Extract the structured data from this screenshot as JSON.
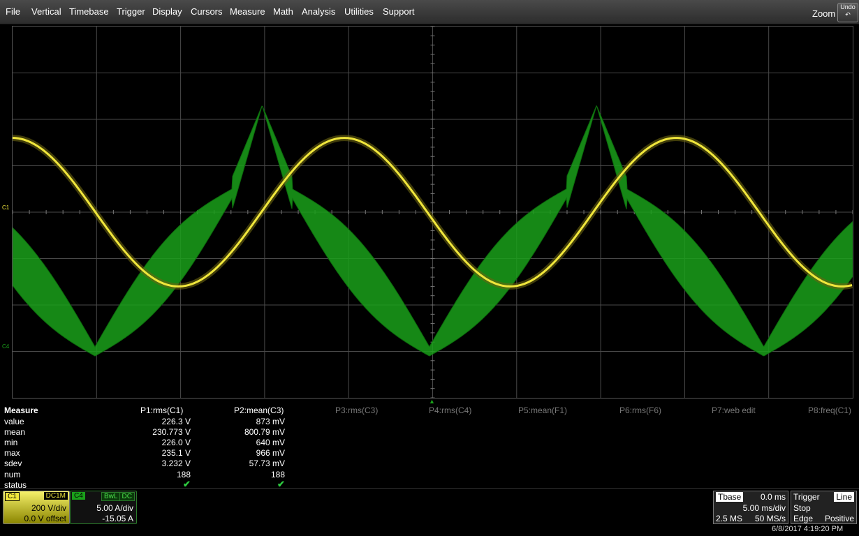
{
  "menu": [
    "File",
    "Vertical",
    "Timebase",
    "Trigger",
    "Display",
    "Cursors",
    "Measure",
    "Math",
    "Analysis",
    "Utilities",
    "Support"
  ],
  "toolbar": {
    "zoom": "Zoom",
    "undo": "Undo"
  },
  "markers": {
    "c1": "C1",
    "c4": "C4"
  },
  "colors": {
    "c1": "#f0e63c",
    "c4": "#1aa01a",
    "grid": "#4a4a4a"
  },
  "measure": {
    "title": "Measure",
    "rows": [
      "value",
      "mean",
      "min",
      "max",
      "sdev",
      "num",
      "status"
    ],
    "params": [
      {
        "header": "P1:rms(C1)",
        "values": [
          "226.3 V",
          "230.773 V",
          "226.0 V",
          "235.1 V",
          "3.232 V",
          "188"
        ]
      },
      {
        "header": "P2:mean(C3)",
        "values": [
          "873 mV",
          "800.79 mV",
          "640 mV",
          "966 mV",
          "57.73 mV",
          "188"
        ]
      }
    ],
    "inactive": [
      "P3:rms(C3)",
      "P4:rms(C4)",
      "P5:mean(F1)",
      "P6:rms(F6)",
      "P7:web edit",
      "P8:freq(C1)"
    ],
    "status_icon": "checkmark-icon"
  },
  "channels": {
    "c1": {
      "label": "C1",
      "coupling": "DC1M",
      "scale": "200 V/div",
      "offset": "0.0 V offset"
    },
    "c4": {
      "label": "C4",
      "bwl": "BwL",
      "coupling": "DC",
      "scale": "5.00 A/div",
      "offset": "-15.05 A"
    }
  },
  "timebase": {
    "label": "Tbase",
    "delay": "0.0 ms",
    "scale": "5.00 ms/div",
    "samples": "2.5 MS",
    "rate": "50 MS/s"
  },
  "trigger": {
    "label": "Trigger",
    "type": "Line",
    "mode": "Stop",
    "slope_type": "Edge",
    "slope": "Positive"
  },
  "datetime": "6/8/2017 4:19:20 PM",
  "chart_data": {
    "type": "line",
    "grid_divisions": {
      "x": 10,
      "y": 8
    },
    "series": [
      {
        "name": "C1",
        "waveform": "sine",
        "period_div": 3.95,
        "amplitude_div": 1.6,
        "offset_div": 0
      },
      {
        "name": "C4",
        "waveform": "triangle-with-spikes",
        "period_div": 3.98,
        "min_div": -3.0,
        "spike_div": 2.3
      }
    ]
  }
}
